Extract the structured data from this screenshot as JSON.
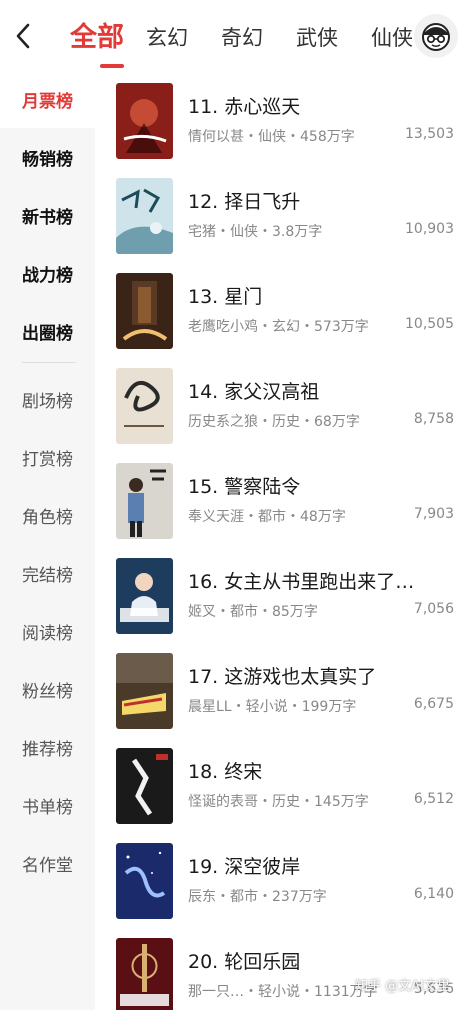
{
  "header": {
    "tabs": [
      {
        "label": "全部",
        "active": true
      },
      {
        "label": "玄幻",
        "active": false
      },
      {
        "label": "奇幻",
        "active": false
      },
      {
        "label": "武侠",
        "active": false
      },
      {
        "label": "仙侠",
        "active": false
      }
    ],
    "back_icon": "chevron-left-icon",
    "avatar_icon": "avatar-icon"
  },
  "sidebar": {
    "items": [
      {
        "label": "月票榜",
        "state": "active"
      },
      {
        "label": "畅销榜",
        "state": "bold"
      },
      {
        "label": "新书榜",
        "state": "bold"
      },
      {
        "label": "战力榜",
        "state": "bold"
      },
      {
        "label": "出圈榜",
        "state": "bold"
      },
      {
        "label": "剧场榜",
        "state": "normal"
      },
      {
        "label": "打赏榜",
        "state": "normal"
      },
      {
        "label": "角色榜",
        "state": "normal"
      },
      {
        "label": "完结榜",
        "state": "normal"
      },
      {
        "label": "阅读榜",
        "state": "normal"
      },
      {
        "label": "粉丝榜",
        "state": "normal"
      },
      {
        "label": "推荐榜",
        "state": "normal"
      },
      {
        "label": "书单榜",
        "state": "normal"
      },
      {
        "label": "名作堂",
        "state": "normal"
      }
    ]
  },
  "books": [
    {
      "title": "11. 赤心巡天",
      "meta": "情何以甚・仙侠・458万字",
      "count": "13,503",
      "cover_bg": "#8a1f1a"
    },
    {
      "title": "12. 择日飞升",
      "meta": "宅猪・仙侠・3.8万字",
      "count": "10,903",
      "cover_bg": "#cfe4ea"
    },
    {
      "title": "13. 星门",
      "meta": "老鹰吃小鸡・玄幻・573万字",
      "count": "10,505",
      "cover_bg": "#3a2418"
    },
    {
      "title": "14. 家父汉高祖",
      "meta": "历史系之狼・历史・68万字",
      "count": "8,758",
      "cover_bg": "#e8e0d2"
    },
    {
      "title": "15. 警察陆令",
      "meta": "奉义天涯・都市・48万字",
      "count": "7,903",
      "cover_bg": "#d9d6cf"
    },
    {
      "title": "16. 女主从书里跑出来了…",
      "meta": "姬叉・都市・85万字",
      "count": "7,056",
      "cover_bg": "#1e3d5e"
    },
    {
      "title": "17. 这游戏也太真实了",
      "meta": "晨星LL・轻小说・199万字",
      "count": "6,675",
      "cover_bg": "#4a3a2a"
    },
    {
      "title": "18. 终宋",
      "meta": "怪诞的表哥・历史・145万字",
      "count": "6,512",
      "cover_bg": "#1a1a1a"
    },
    {
      "title": "19. 深空彼岸",
      "meta": "辰东・都市・237万字",
      "count": "6,140",
      "cover_bg": "#1b2a6b"
    },
    {
      "title": "20. 轮回乐园",
      "meta": "那一只…・轻小说・1131万字",
      "count": "5,636",
      "cover_bg": "#5a0f14"
    }
  ],
  "watermark": "知乎 @文AI文里"
}
